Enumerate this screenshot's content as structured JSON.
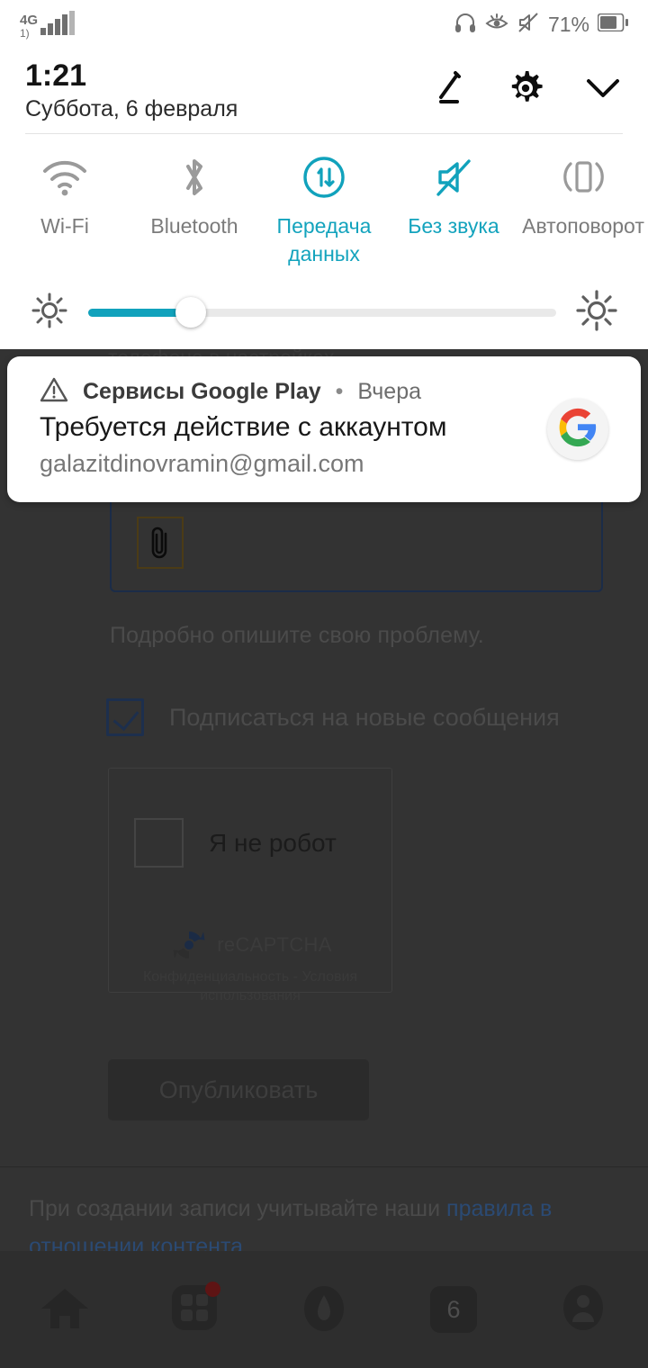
{
  "status_bar": {
    "network_label": "4G",
    "network_sub": "1)",
    "battery_percent": "71%",
    "icons": [
      "headset-icon",
      "eye-comfort-icon",
      "mute-icon",
      "battery-icon"
    ]
  },
  "quick_settings": {
    "clock": "1:21",
    "date": "Суббота, 6 февраля",
    "actions": [
      "edit-icon",
      "settings-gear-icon",
      "collapse-chevron-icon"
    ],
    "tiles": [
      {
        "label": "Wi-Fi",
        "icon": "wifi-icon",
        "active": false
      },
      {
        "label": "Bluetooth",
        "icon": "bluetooth-icon",
        "active": false
      },
      {
        "label": "Передача данных",
        "icon": "data-transfer-icon",
        "active": true
      },
      {
        "label": "Без звука",
        "icon": "mute-icon",
        "active": true
      },
      {
        "label": "Автоповорот",
        "icon": "auto-rotate-icon",
        "active": false
      }
    ],
    "brightness": {
      "value_percent": 22,
      "low_icon": "brightness-low-icon",
      "high_icon": "brightness-high-icon"
    },
    "accent_color": "#11a2bc"
  },
  "notification": {
    "warning_icon": "warning-triangle-icon",
    "app_name": "Сервисы Google Play",
    "separator": "•",
    "time": "Вчера",
    "title": "Требуется действие с аккаунтом",
    "subtitle": "galazitdinovramin@gmail.com",
    "avatar_icon": "google-g-icon"
  },
  "app_background": {
    "clipped_line": "телефоне в настройках",
    "attachment": {
      "icon": "paperclip-icon",
      "border_color": "#1b2c48"
    },
    "hint_text": "Подробно опишите свою проблему.",
    "subscribe": {
      "label": "Подписаться на новые сообщения",
      "checked": true
    },
    "recaptcha": {
      "label": "Я не робот",
      "brand": "reCAPTCHA",
      "terms_line1": "Конфиденциальность - Условия",
      "terms_line2": "использования",
      "logo_icon": "recaptcha-logo-icon"
    },
    "publish_button": "Опубликовать",
    "footer": {
      "text_before": "При создании записи учитывайте наши ",
      "link_text": "правила в отношении контента",
      "text_after": "."
    }
  },
  "bottom_nav": {
    "items": [
      {
        "name": "home",
        "icon": "home-icon",
        "badge": false
      },
      {
        "name": "apps",
        "icon": "grid-apps-icon",
        "badge": true
      },
      {
        "name": "shield",
        "icon": "water-drop-icon",
        "badge": false
      },
      {
        "name": "tabs",
        "icon": "tab-count-icon",
        "label": "6",
        "badge": false
      },
      {
        "name": "profile",
        "icon": "profile-avatar-icon",
        "badge": false
      }
    ]
  }
}
